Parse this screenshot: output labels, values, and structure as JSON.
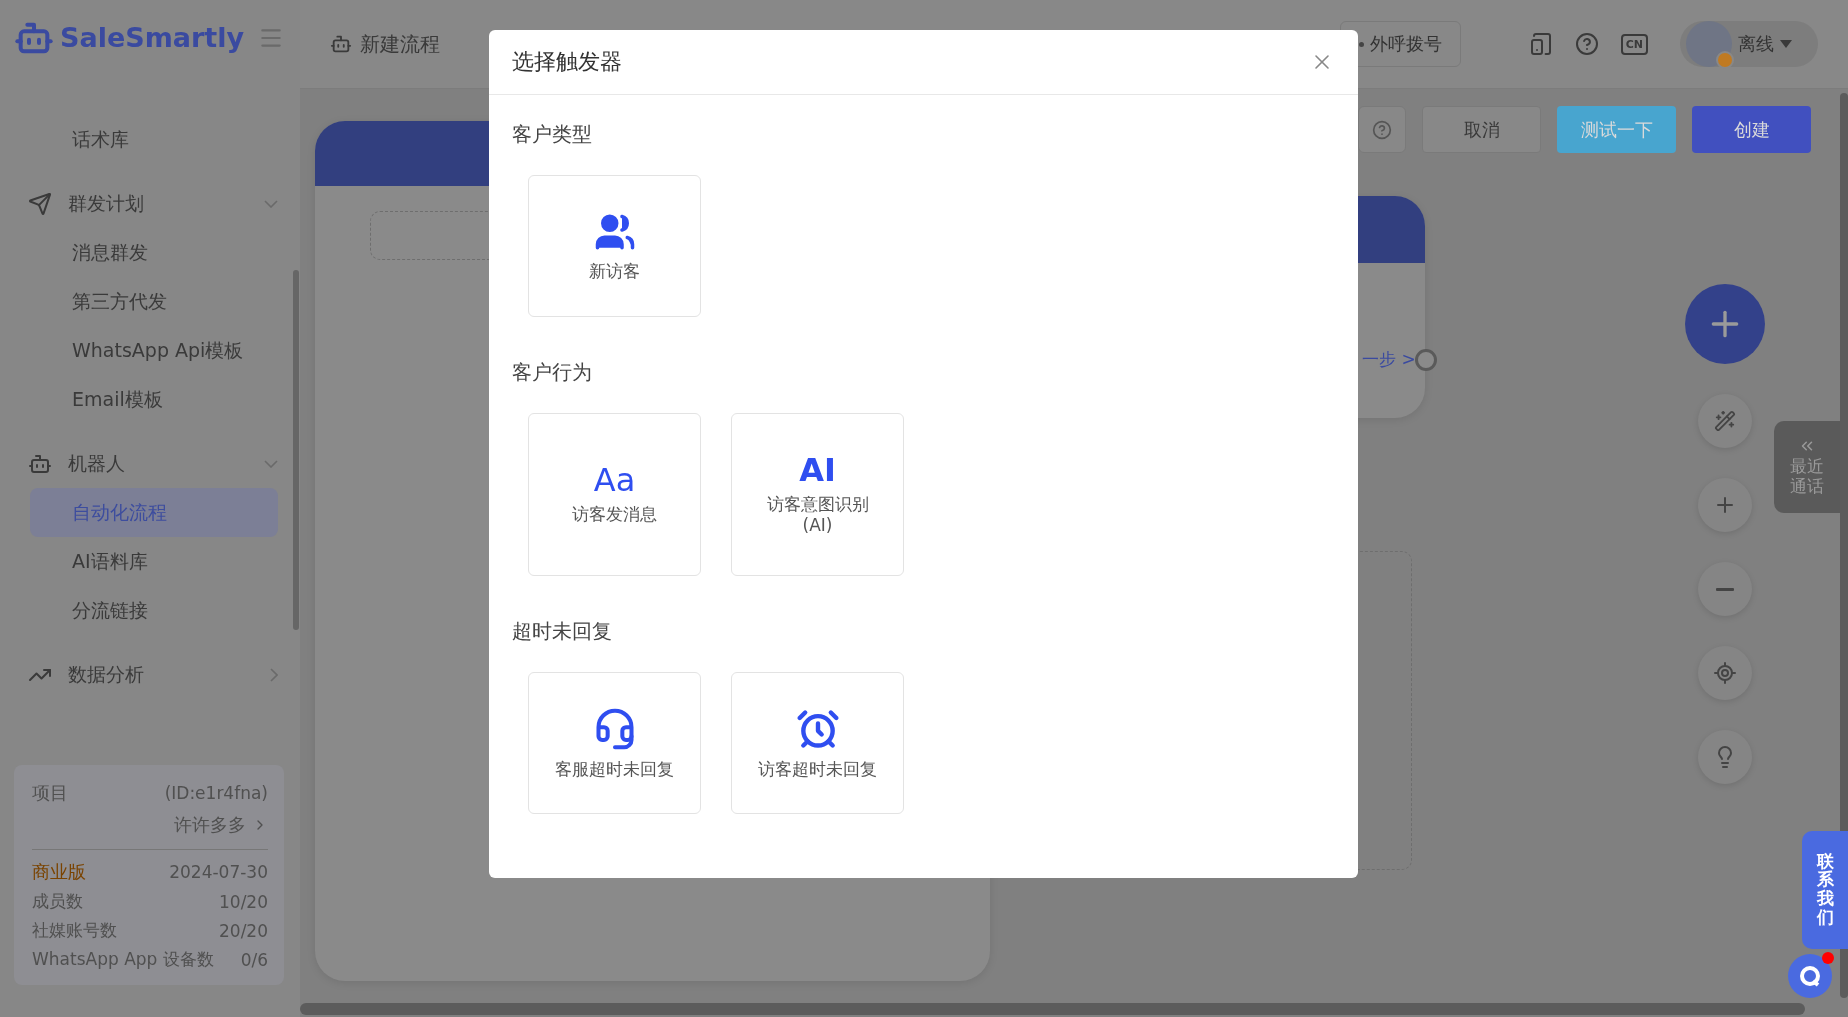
{
  "logo": {
    "text": "SaleSmartly"
  },
  "sidebar": {
    "menu": [
      {
        "kind": "item",
        "label": "话术库",
        "selected": false
      },
      {
        "kind": "group",
        "label": "群发计划",
        "expanded": true
      },
      {
        "kind": "item",
        "label": "消息群发",
        "selected": false
      },
      {
        "kind": "item",
        "label": "第三方代发",
        "selected": false
      },
      {
        "kind": "item",
        "label": "WhatsApp Api模板",
        "selected": false
      },
      {
        "kind": "item",
        "label": "Email模板",
        "selected": false
      },
      {
        "kind": "group",
        "label": "机器人",
        "expanded": true
      },
      {
        "kind": "item",
        "label": "自动化流程",
        "selected": true
      },
      {
        "kind": "item",
        "label": "AI语料库",
        "selected": false
      },
      {
        "kind": "item",
        "label": "分流链接",
        "selected": false
      },
      {
        "kind": "group",
        "label": "数据分析",
        "expanded": false
      }
    ]
  },
  "plan_card": {
    "title": "项目",
    "id": "(ID:e1r4fna)",
    "owner": "许许多多",
    "plan": "商业版",
    "expiry": "2024-07-30",
    "quotas": [
      {
        "label": "成员数",
        "value": "10/20"
      },
      {
        "label": "社媒账号数",
        "value": "20/20"
      },
      {
        "label": "WhatsApp App 设备数",
        "value": "0/6"
      }
    ]
  },
  "header": {
    "title": "新建流程",
    "call_button": "外呼拨号",
    "language": "CN",
    "user_status": "离线"
  },
  "toolbar": {
    "buttons": [
      {
        "kind": "default",
        "label": "取消"
      },
      {
        "kind": "info",
        "label": "测试一下"
      },
      {
        "kind": "primary",
        "label": "创建"
      }
    ]
  },
  "canvas": {
    "next_step": "一步 >"
  },
  "recent_calls": {
    "label": "最近通话"
  },
  "contact": {
    "label": "联系我们"
  },
  "dialog": {
    "title": "选择触发器",
    "sections": [
      {
        "title": "客户类型",
        "options": [
          {
            "kind": "visitors",
            "label": "新访客"
          }
        ]
      },
      {
        "title": "客户行为",
        "options": [
          {
            "kind": "glyph",
            "glyph": "Aa",
            "label": "访客发消息"
          },
          {
            "kind": "glyph",
            "glyph": "AI",
            "label": "访客意图识别\n(AI)"
          }
        ]
      },
      {
        "title": "超时未回复",
        "options": [
          {
            "kind": "headset",
            "label": "客服超时未回复"
          },
          {
            "kind": "alarm",
            "label": "访客超时未回复"
          }
        ]
      }
    ]
  }
}
